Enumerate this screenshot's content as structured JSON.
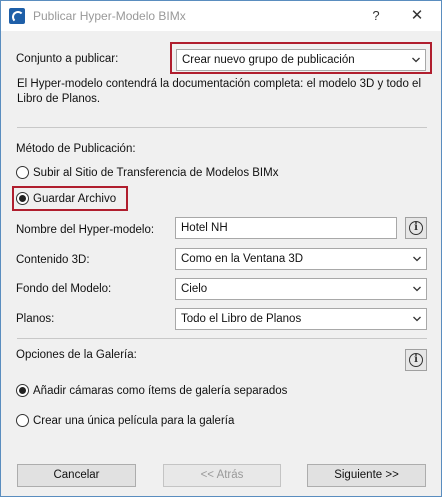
{
  "window": {
    "title": "Publicar Hyper-Modelo BIMx",
    "help_label": "?",
    "close_label": "✕"
  },
  "publish_set": {
    "label": "Conjunto a publicar:",
    "selected": "Crear nuevo grupo de publicación",
    "description": "El Hyper-modelo contendrá la documentación completa: el modelo 3D y todo el Libro de Planos."
  },
  "publish_method": {
    "heading": "Método de Publicación:",
    "options": [
      {
        "label": "Subir al Sitio de Transferencia de Modelos BIMx",
        "selected": false
      },
      {
        "label": "Guardar Archivo",
        "selected": true
      }
    ]
  },
  "settings": {
    "name_label": "Nombre del Hyper-modelo:",
    "name_value": "Hotel NH",
    "content3d_label": "Contenido 3D:",
    "content3d_value": "Como en la Ventana 3D",
    "background_label": "Fondo del Modelo:",
    "background_value": "Cielo",
    "sheets_label": "Planos:",
    "sheets_value": "Todo el Libro de Planos"
  },
  "gallery": {
    "heading": "Opciones de la Galería:",
    "options": [
      {
        "label": "Añadir cámaras como ítems de galería separados",
        "selected": true
      },
      {
        "label": "Crear una única película para la galería",
        "selected": false
      }
    ]
  },
  "footer": {
    "cancel_label": "Cancelar",
    "back_label": "<< Atrás",
    "next_label": "Siguiente >>"
  },
  "colors": {
    "highlight": "#b01e2e",
    "window_border": "#5a8dbf",
    "app_icon": "#1e5fa8"
  },
  "icons": [
    "app-icon",
    "help-icon",
    "close-icon",
    "info-icon",
    "chevron-down-icon"
  ]
}
